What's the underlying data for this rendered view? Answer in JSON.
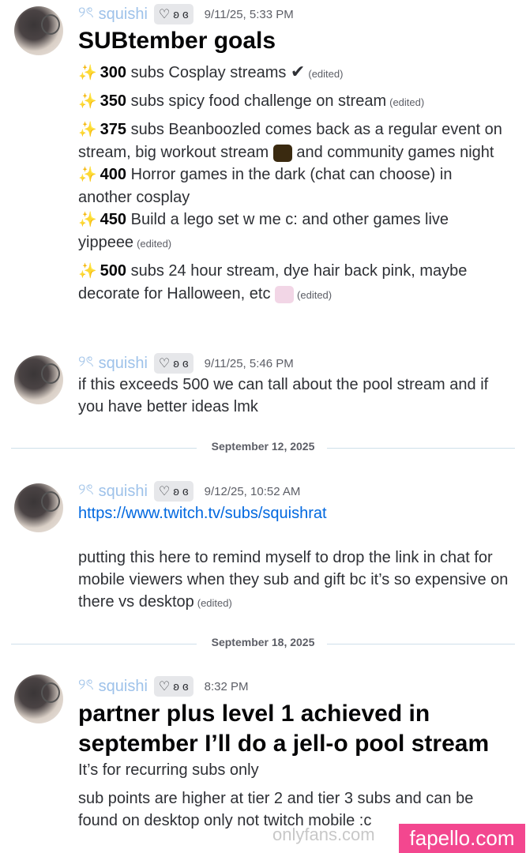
{
  "messages": [
    {
      "username": "squishi",
      "name_glyph": "୨ৎ",
      "tag": "ʚ ɞ",
      "timestamp": "9/11/25, 5:33 PM",
      "title": "SUBtember goals",
      "goals": [
        {
          "count": "300",
          "text": "subs Cosplay streams",
          "check": "✔",
          "edited": "(edited)"
        },
        {
          "count": "350",
          "text": "subs spicy food challenge on stream",
          "edited": "(edited)"
        },
        {
          "count": "375",
          "text_a": "subs Beanboozled comes back as a regular event on stream, big workout stream",
          "text_b": "and community games night"
        },
        {
          "count": "400",
          "text": "Horror games in the dark (chat can choose) in another cosplay"
        },
        {
          "count": "450",
          "text": "Build a lego set w me c: and other games live yippeee",
          "edited": "(edited)"
        },
        {
          "count": "500",
          "text": "subs 24 hour stream, dye hair back pink, maybe decorate for Halloween, etc",
          "edited": "(edited)"
        }
      ],
      "goal_icon": "sparkle-stars-icon"
    },
    {
      "username": "squishi",
      "name_glyph": "୨ৎ",
      "tag": "ʚ ɞ",
      "timestamp": "9/11/25, 5:46 PM",
      "text": "if this exceeds 500 we can tall about the pool stream and if you have better ideas lmk"
    },
    {
      "username": "squishi",
      "name_glyph": "୨ৎ",
      "tag": "ʚ ɞ",
      "timestamp": "9/12/25, 10:52 AM",
      "link": "https://www.twitch.tv/subs/squishrat",
      "text": "putting this here to remind myself to drop the link in chat for mobile viewers when they sub and gift bc it’s so expensive on there vs desktop",
      "edited": "(edited)"
    },
    {
      "username": "squishi",
      "name_glyph": "୨ৎ",
      "tag": "ʚ ɞ",
      "timestamp": "8:32 PM",
      "title": "partner plus level 1 achieved in september I’ll do a jell-o pool stream",
      "line1": "It’s for recurring subs only",
      "line2": "sub points are higher at tier 2 and tier 3 subs and can be found on desktop only not twitch mobile :c"
    }
  ],
  "dividers": [
    "September 12, 2025",
    "September 18, 2025"
  ],
  "watermarks": {
    "left": "onlyfans.com",
    "right": "fapello.com"
  },
  "colors": {
    "username": "#9ec2ea",
    "link": "#0068e0",
    "watermark": "#f3478f"
  }
}
